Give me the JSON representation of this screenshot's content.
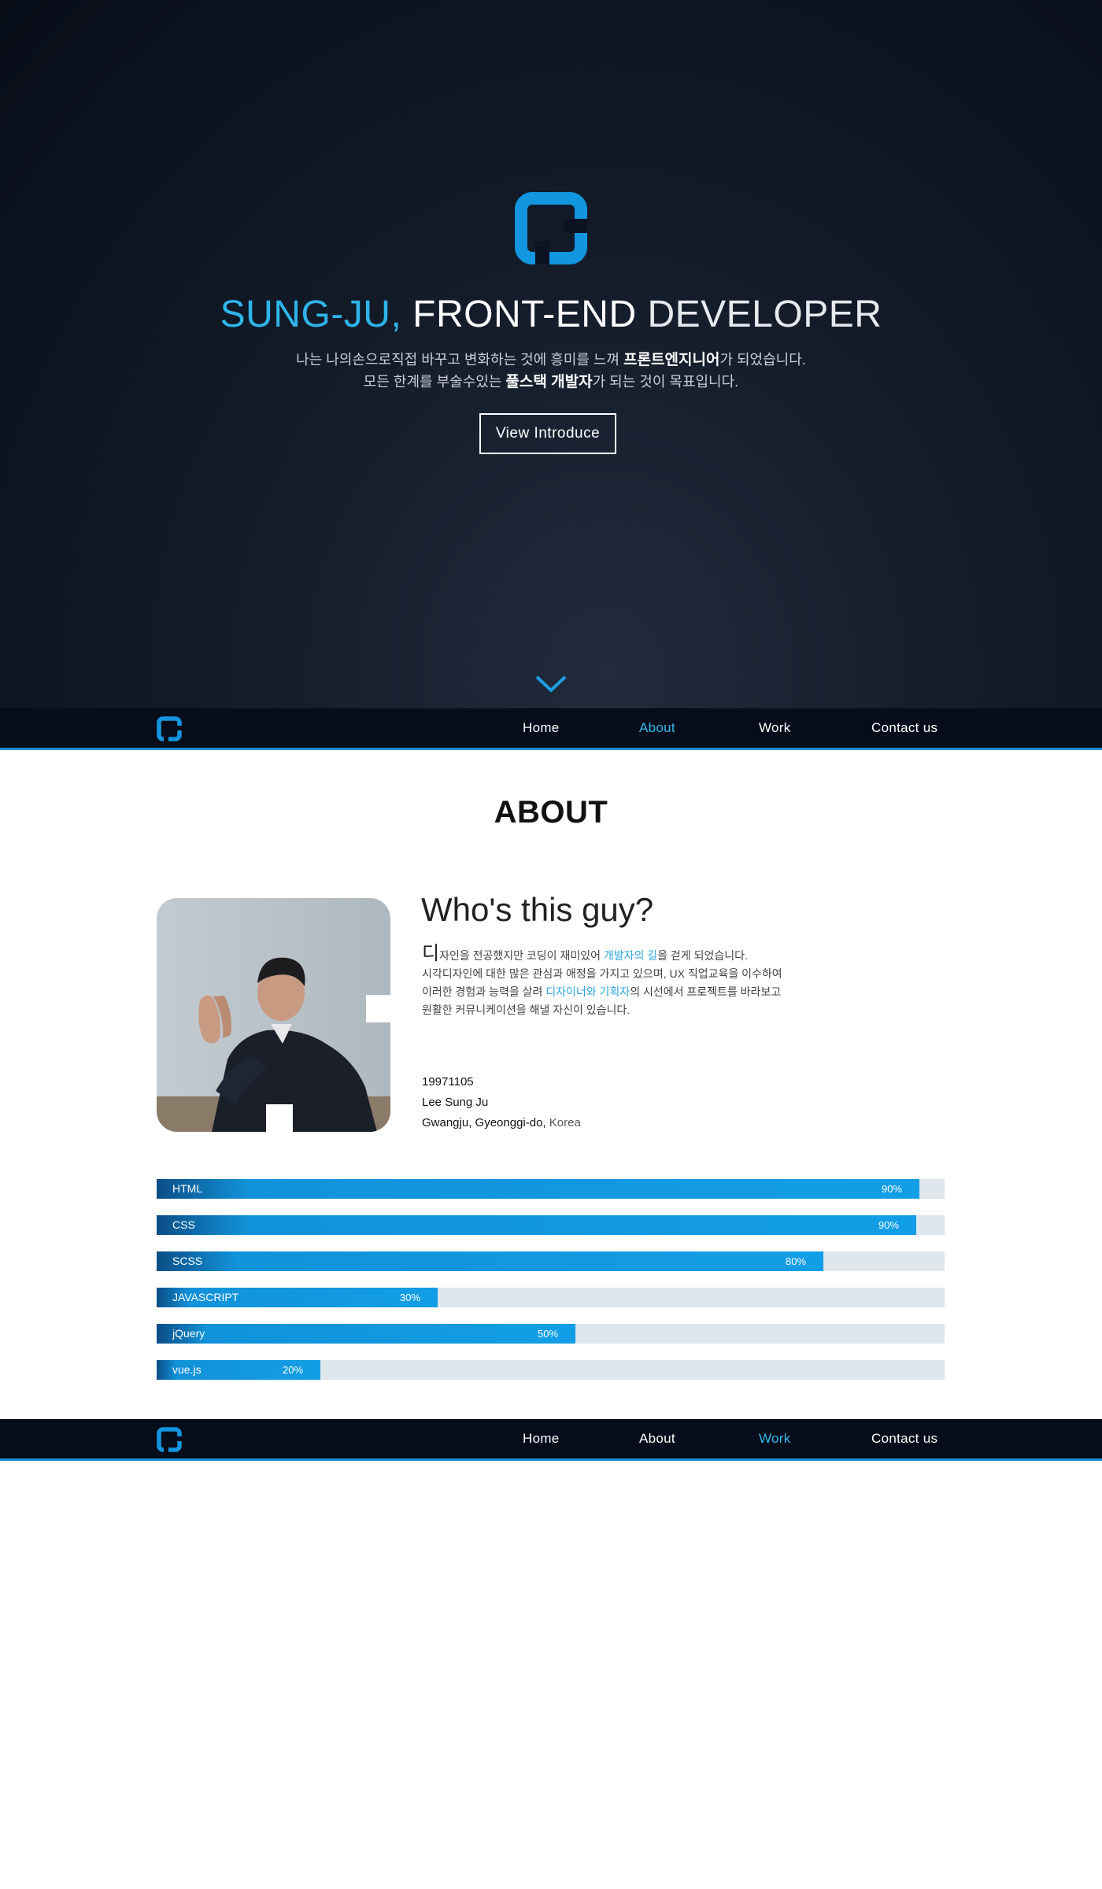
{
  "hero": {
    "title_highlight": "SUNG-JU,",
    "title_main": "FRONT-END",
    "title_thin": "DEVELOPER",
    "line1_a": "나는 나의손으로직접 바꾸고 변화하는 것에 흥미를 느껴 ",
    "line1_bold": "프론트엔지니어",
    "line1_b": "가 되었습니다.",
    "line2_a": "모든 한계를 부술수있는 ",
    "line2_bold": "풀스택 개발자",
    "line2_b": "가 되는 것이 목표입니다.",
    "button_label": "View Introduce"
  },
  "nav_top": {
    "home": "Home",
    "about": "About",
    "work": "Work",
    "contact": "Contact us",
    "active": "About"
  },
  "nav_bottom": {
    "home": "Home",
    "about": "About",
    "work": "Work",
    "contact": "Contact us",
    "active": "Work"
  },
  "about": {
    "heading": "ABOUT",
    "who_title": "Who's this guy?",
    "bio": {
      "l1_big": "디",
      "l1_a": "자인을 전공했지만 코딩이 재미있어 ",
      "l1_hl": "개발자의 길",
      "l1_b": "을 걷게 되었습니다.",
      "l2": "시각디자인에 대한 많은 관심과 애정을 가지고 있으며, UX 직업교육을 이수하여",
      "l3_a": "이러한 경험과 능력을 살려 ",
      "l3_hl": "디자이너와 기획자",
      "l3_b": "의 시선에서 ",
      "l3_bold": "프로젝트",
      "l3_c": "를 바라보고",
      "l4": "원활한 커뮤니케이션을 해낼 자신이 있습니다."
    },
    "birth": "19971105",
    "name": "Lee Sung Ju",
    "location_a": "Gwangju, Gyeonggi-do,",
    "location_b": "Korea"
  },
  "skills": [
    {
      "name": "HTML",
      "percent": 90,
      "label": "90%",
      "fill": 0.968
    },
    {
      "name": "CSS",
      "percent": 90,
      "label": "90%",
      "fill": 0.964
    },
    {
      "name": "SCSS",
      "percent": 80,
      "label": "80%",
      "fill": 0.846
    },
    {
      "name": "JAVASCRIPT",
      "percent": 30,
      "label": "30%",
      "fill": 0.357
    },
    {
      "name": "jQuery",
      "percent": 50,
      "label": "50%",
      "fill": 0.531
    },
    {
      "name": "vue.js",
      "percent": 20,
      "label": "20%",
      "fill": 0.208
    }
  ],
  "colors": {
    "accent": "#2fb4ea",
    "nav_bg": "#050d1b",
    "bar_fill": "#129ee6",
    "bar_track": "#dfe6ec"
  },
  "icons": {
    "logo": "brand-logo-icon",
    "scroll": "chevron-down-icon"
  }
}
